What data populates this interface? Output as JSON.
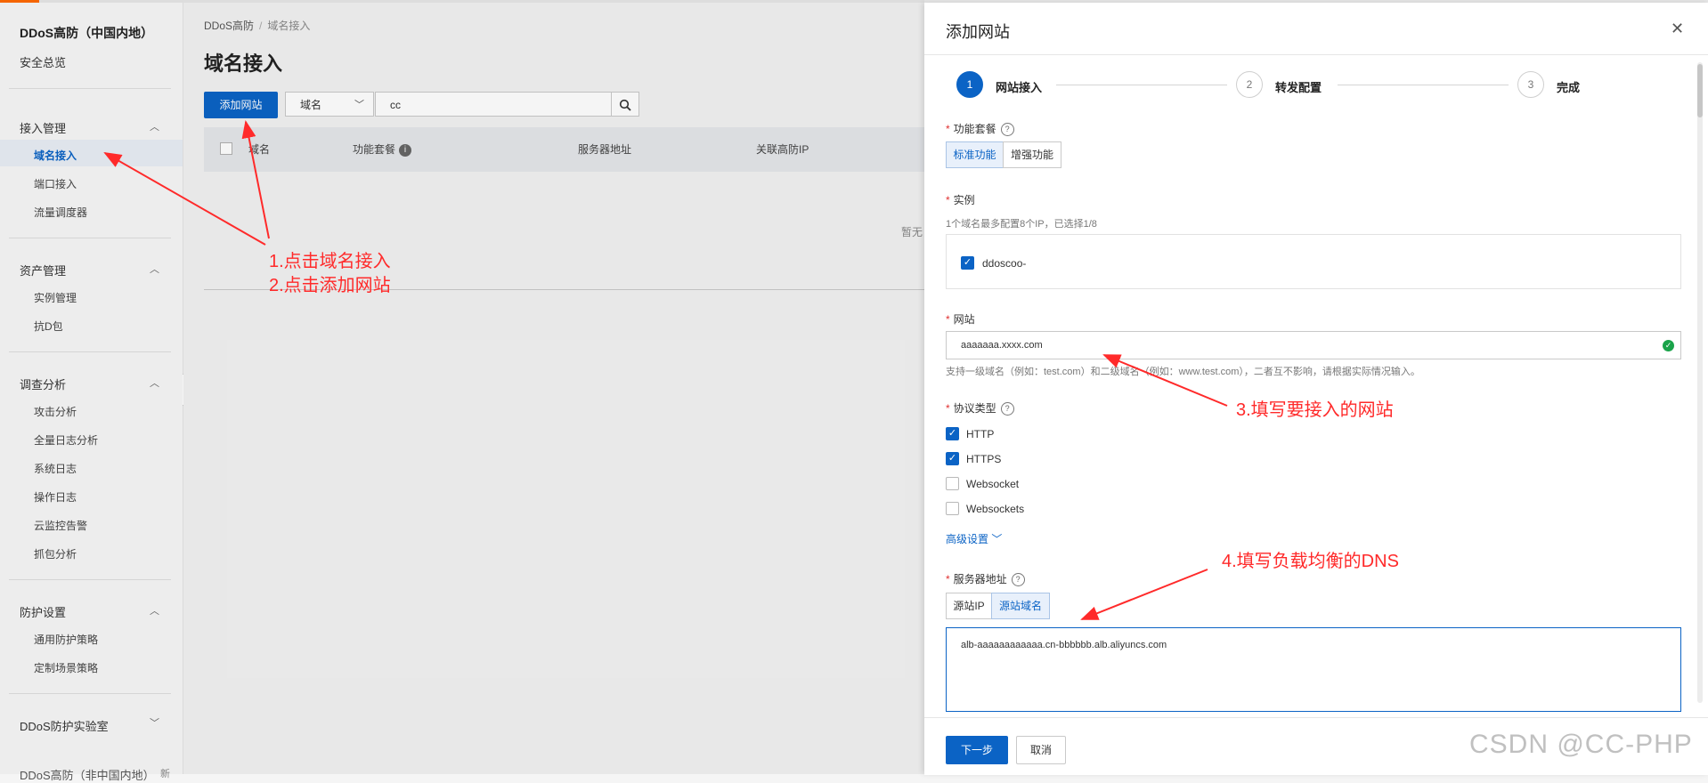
{
  "sidebar": {
    "title": "DDoS高防（中国内地）",
    "overview": "安全总览",
    "groups": [
      {
        "label": "接入管理",
        "items": [
          "域名接入",
          "端口接入",
          "流量调度器"
        ]
      },
      {
        "label": "资产管理",
        "items": [
          "实例管理",
          "抗D包"
        ]
      },
      {
        "label": "调查分析",
        "items": [
          "攻击分析",
          "全量日志分析",
          "系统日志",
          "操作日志",
          "云监控告警",
          "抓包分析"
        ]
      },
      {
        "label": "防护设置",
        "items": [
          "通用防护策略",
          "定制场景策略"
        ]
      }
    ],
    "lab": "DDoS防护实验室",
    "bottom_cut": "DDoS高防（非中国内地）",
    "bottom_badge": "新"
  },
  "main": {
    "breadcrumb": [
      "DDoS高防",
      "域名接入"
    ],
    "title": "域名接入",
    "add_button": "添加网站",
    "filter_select": "域名",
    "search_value": "cc",
    "columns": [
      "域名",
      "功能套餐",
      "服务器地址",
      "关联高防IP"
    ],
    "empty_text": "暂无"
  },
  "drawer": {
    "title": "添加网站",
    "steps": [
      {
        "num": "1",
        "label": "网站接入"
      },
      {
        "num": "2",
        "label": "转发配置"
      },
      {
        "num": "3",
        "label": "完成"
      }
    ],
    "package": {
      "label": "功能套餐",
      "options": [
        "标准功能",
        "增强功能"
      ]
    },
    "instance": {
      "label": "实例",
      "hint": "1个域名最多配置8个IP，已选择1/8",
      "item": "ddoscoo-"
    },
    "website": {
      "label": "网站",
      "value": "aaaaaaa.xxxx.com",
      "hint": "支持一级域名（例如：test.com）和二级域名（例如：www.test.com），二者互不影响，请根据实际情况输入。"
    },
    "protocol": {
      "label": "协议类型",
      "options": [
        {
          "label": "HTTP",
          "checked": true
        },
        {
          "label": "HTTPS",
          "checked": true
        },
        {
          "label": "Websocket",
          "checked": false
        },
        {
          "label": "Websockets",
          "checked": false
        }
      ]
    },
    "advanced": "高级设置",
    "server": {
      "label": "服务器地址",
      "tabs": [
        "源站IP",
        "源站域名"
      ],
      "value": "alb-aaaaaaaaaaaa.cn-bbbbbb.alb.aliyuncs.com"
    },
    "next_button": "下一步",
    "cancel_button": "取消"
  },
  "annotations": {
    "note1": "1.点击域名接入",
    "note2": "2.点击添加网站",
    "note3": "3.填写要接入的网站",
    "note4": "4.填写负载均衡的DNS",
    "color": "#ff2a2a"
  },
  "watermark": "CSDN @CC-PHP"
}
